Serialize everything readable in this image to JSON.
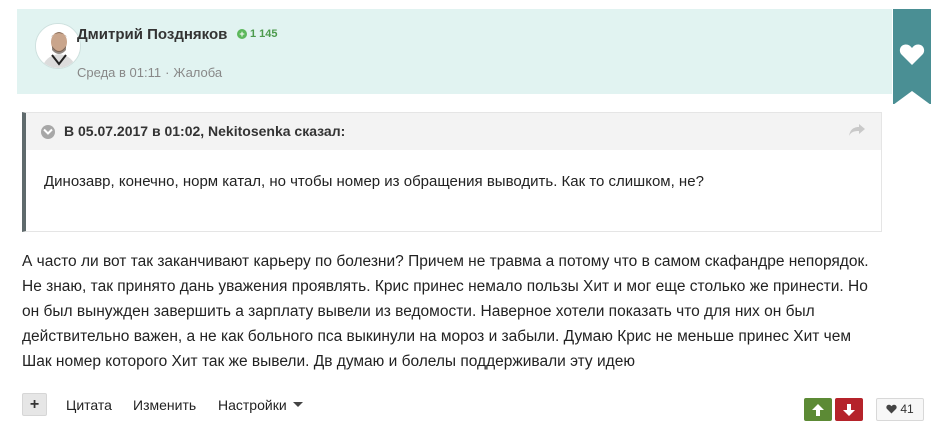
{
  "post": {
    "author": "Дмитрий Поздняков",
    "reputation": "1 145",
    "time": "Среда в 01:11",
    "separator": "·",
    "complaint_label": "Жалоба"
  },
  "quote": {
    "header": "В 05.07.2017 в 01:02, Nekitosenka сказал:",
    "text": "Динозавр, конечно, норм катал, но чтобы номер из обращения выводить. Как то слишком, не?"
  },
  "body": {
    "text": "А часто ли вот так заканчивают карьеру по болезни? Причем не травма а потому что в самом скафандре непорядок. Не знаю, так принято дань уважения проявлять. Крис принес немало пользы Хит и мог еще столько же принести. Но он был вынужден завершить а зарплату вывели из ведомости. Наверное хотели показать что для них он был действительно важен, а не как больного пса выкинули на мороз и забыли. Думаю Крис не меньше принес Хит чем Шак номер которого Хит так же вывели. Дв думаю и болелы поддерживали эту идею"
  },
  "footer": {
    "plus_label": "+",
    "quote_label": "Цитата",
    "edit_label": "Изменить",
    "settings_label": "Настройки",
    "likes_count": "41"
  },
  "colors": {
    "header_bg": "#e1f3f1",
    "ribbon": "#4a8f94",
    "vote_up": "#5c8a35",
    "vote_down": "#b5232a",
    "reputation": "#5cb85c"
  },
  "icons": {
    "ribbon": "heart-icon",
    "quote_toggle": "chevron-down-icon",
    "quote_share": "share-arrow-icon",
    "vote_up": "arrow-up-icon",
    "vote_down": "arrow-down-icon",
    "likes": "heart-icon"
  }
}
